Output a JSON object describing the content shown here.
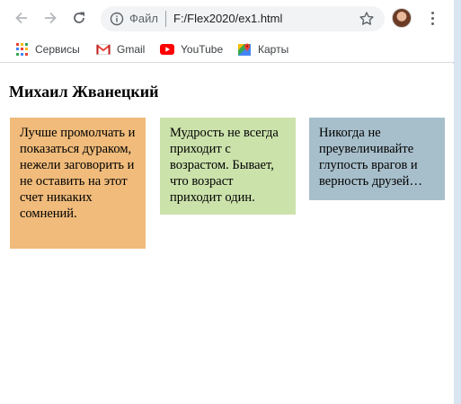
{
  "browser": {
    "back_icon": "arrow-left-icon",
    "forward_icon": "arrow-right-icon",
    "reload_icon": "reload-icon",
    "address": {
      "info_icon": "info-icon",
      "scheme_label": "Файл",
      "url": "F:/Flex2020/ex1.html"
    },
    "bookmark_star_icon": "star-icon",
    "menu_icon": "kebab-menu-icon"
  },
  "bookmarks": [
    {
      "label": "Сервисы",
      "icon": "apps-grid-icon"
    },
    {
      "label": "Gmail",
      "icon": "gmail-icon"
    },
    {
      "label": "YouTube",
      "icon": "youtube-icon"
    },
    {
      "label": "Карты",
      "icon": "maps-icon"
    }
  ],
  "page": {
    "title": "Михаил Жванецкий",
    "quotes": [
      {
        "text": "Лучше промолчать и показаться дураком, нежели заговорить и не оставить на этот счет никаких сомнений.",
        "color": "#f0bb7b"
      },
      {
        "text": "Мудрость не всегда приходит с возрастом. Бывает, что возраст приходит один.",
        "color": "#cbe2ab"
      },
      {
        "text": "Никогда не преувеличивайте глупость врагов и верность друзей…",
        "color": "#a7bfcb"
      }
    ]
  }
}
